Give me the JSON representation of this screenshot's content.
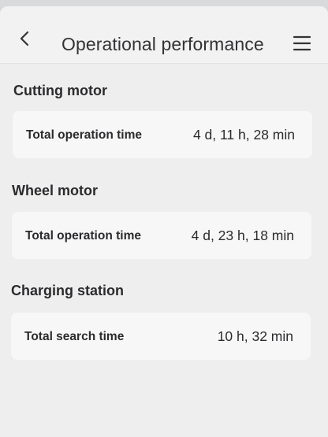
{
  "header": {
    "title": "Operational performance",
    "back_icon": "chevron-left-icon",
    "menu_icon": "hamburger-menu-icon"
  },
  "sections": [
    {
      "heading": "Cutting motor",
      "label": "Total operation time",
      "value": "4 d, 11 h, 28 min"
    },
    {
      "heading": "Wheel motor",
      "label": "Total operation time",
      "value": "4 d, 23 h, 18 min"
    },
    {
      "heading": "Charging station",
      "label": "Total search time",
      "value": "10 h, 32 min"
    }
  ]
}
